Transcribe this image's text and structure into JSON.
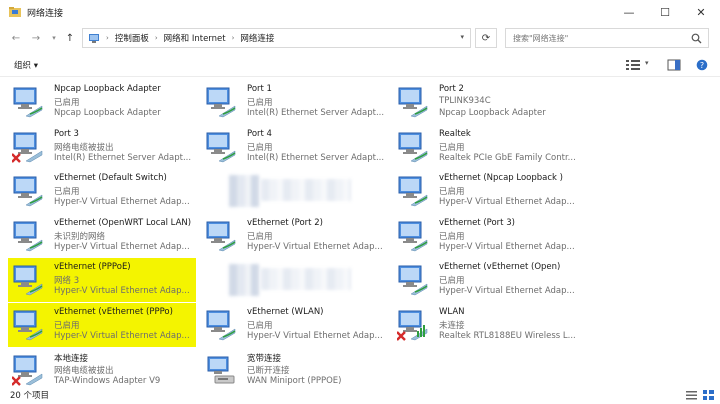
{
  "window": {
    "title": "网络连接"
  },
  "address": {
    "crumbs": [
      "控制面板",
      "网络和 Internet",
      "网络连接"
    ]
  },
  "search": {
    "placeholder": "搜索\"网络连接\""
  },
  "toolbar": {
    "organize_label": "组织 ▾"
  },
  "items": [
    {
      "name": "Npcap Loopback Adapter",
      "status": "已启用",
      "device": "Npcap Loopback Adapter",
      "state": "ok",
      "highlight": false
    },
    {
      "name": "Port 3",
      "status": "网络电缆被拔出",
      "device": "Intel(R) Ethernet Server Adapt...",
      "state": "error",
      "highlight": false
    },
    {
      "name": "vEthernet (Default Switch)",
      "status": "已启用",
      "device": "Hyper-V Virtual Ethernet Adap...",
      "state": "ok",
      "highlight": false
    },
    {
      "name": "vEthernet (OpenWRT Local LAN)",
      "status": "未识别的网络",
      "device": "Hyper-V Virtual Ethernet Adap...",
      "state": "ok",
      "highlight": false
    },
    {
      "name": "vEthernet (PPPoE)",
      "status": "网络 3",
      "device": "Hyper-V Virtual Ethernet Adap...",
      "state": "ok",
      "highlight": true
    },
    {
      "name": "vEthernet (vEthernet (PPPo)",
      "status": "已启用",
      "device": "Hyper-V Virtual Ethernet Adap...",
      "state": "ok",
      "highlight": true
    },
    {
      "name": "本地连接",
      "status": "网络电缆被拔出",
      "device": "TAP-Windows Adapter V9",
      "state": "error",
      "highlight": false
    },
    {
      "name": "Port 1",
      "status": "已启用",
      "device": "Intel(R) Ethernet Server Adapt...",
      "state": "ok",
      "highlight": false
    },
    {
      "name": "Port 4",
      "status": "已启用",
      "device": "Intel(R) Ethernet Server Adapt...",
      "state": "ok",
      "highlight": false
    },
    {
      "name": "",
      "status": "",
      "device": "",
      "state": "blurred",
      "highlight": false
    },
    {
      "name": "vEthernet (Port 2)",
      "status": "已启用",
      "device": "Hyper-V Virtual Ethernet Adap...",
      "state": "ok",
      "highlight": false
    },
    {
      "name": "",
      "status": "",
      "device": "",
      "state": "blurred",
      "highlight": false
    },
    {
      "name": "vEthernet (WLAN)",
      "status": "已启用",
      "device": "Hyper-V Virtual Ethernet Adap...",
      "state": "ok",
      "highlight": false
    },
    {
      "name": "宽带连接",
      "status": "已断开连接",
      "device": "WAN Miniport (PPPOE)",
      "state": "dialup",
      "highlight": false
    },
    {
      "name": "Port 2",
      "status": "TPLINK934C",
      "device": "Npcap Loopback Adapter",
      "state": "ok",
      "highlight": false
    },
    {
      "name": "Realtek",
      "status": "已启用",
      "device": "Realtek PCIe GbE Family Contr...",
      "state": "ok",
      "highlight": false
    },
    {
      "name": "vEthernet (Npcap Loopback )",
      "status": "已启用",
      "device": "Hyper-V Virtual Ethernet Adap...",
      "state": "ok",
      "highlight": false
    },
    {
      "name": "vEthernet (Port 3)",
      "status": "已启用",
      "device": "Hyper-V Virtual Ethernet Adap...",
      "state": "ok",
      "highlight": false
    },
    {
      "name": "vEthernet (vEthernet (Open)",
      "status": "已启用",
      "device": "Hyper-V Virtual Ethernet Adap...",
      "state": "ok",
      "highlight": false
    },
    {
      "name": "WLAN",
      "status": "未连接",
      "device": "Realtek RTL8188EU Wireless L...",
      "state": "wifi-error",
      "highlight": false
    }
  ],
  "status_bar": {
    "count": "20 个项目"
  },
  "colors": {
    "highlight": "#f4f400",
    "error": "#d42a2a",
    "cable": "#2e9e3e"
  }
}
